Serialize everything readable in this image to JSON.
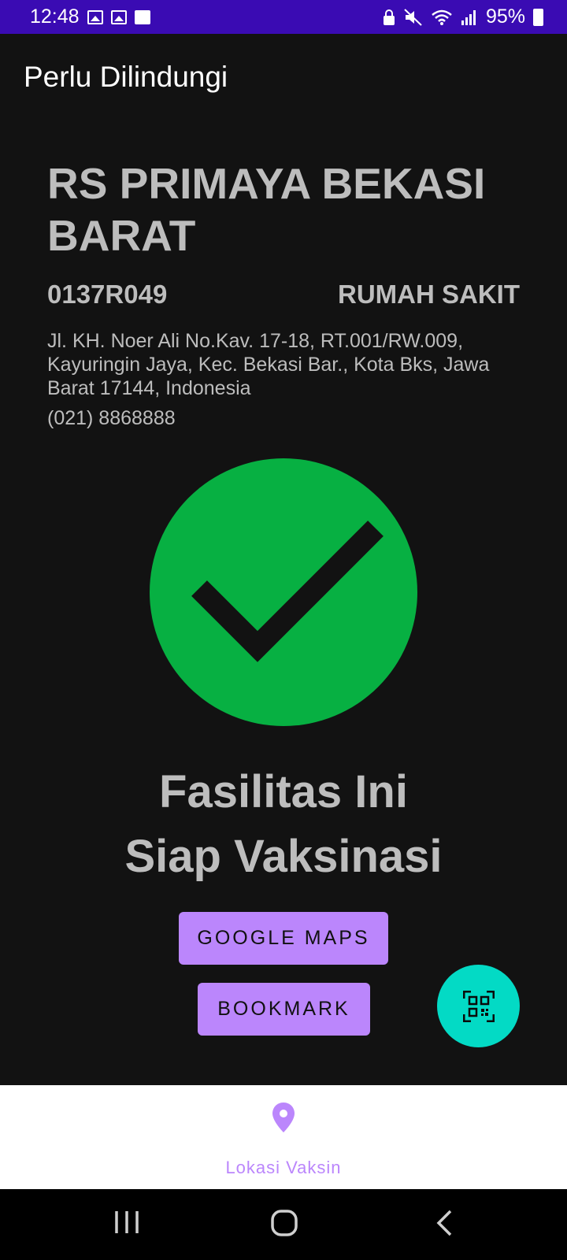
{
  "status_bar": {
    "time": "12:48",
    "battery": "95%",
    "left_icons": [
      "photo-icon",
      "photo-icon",
      "gallery-icon"
    ],
    "right_icons": [
      "lock-icon",
      "mute-icon",
      "wifi-icon",
      "signal-icon",
      "battery-charging-icon"
    ]
  },
  "app_bar": {
    "title": "Perlu Dilindungi"
  },
  "facility": {
    "name": "RS PRIMAYA BEKASI BARAT",
    "code": "0137R049",
    "type": "RUMAH SAKIT",
    "address": "Jl. KH. Noer Ali No.Kav. 17-18, RT.001/RW.009, Kayuringin Jaya, Kec. Bekasi Bar., Kota Bks, Jawa Barat 17144, Indonesia",
    "phone": "(021) 8868888"
  },
  "status": {
    "icon": "check-circle-icon",
    "line1": "Fasilitas Ini",
    "line2": "Siap Vaksinasi"
  },
  "buttons": {
    "google_maps": "GOOGLE MAPS",
    "bookmark": "BOOKMARK"
  },
  "fab": {
    "icon": "qr-scan-icon"
  },
  "bottom_nav": {
    "items": [
      {
        "label": "Lokasi Vaksin",
        "icon": "location-pin-icon",
        "active": true
      }
    ]
  },
  "system_nav": {
    "buttons": [
      "recents-icon",
      "home-icon",
      "back-icon"
    ]
  },
  "colors": {
    "status_bar": "#3a0bb3",
    "background": "#121212",
    "accent": "#bb86fc",
    "fab": "#03dac5",
    "success": "#07b042"
  }
}
